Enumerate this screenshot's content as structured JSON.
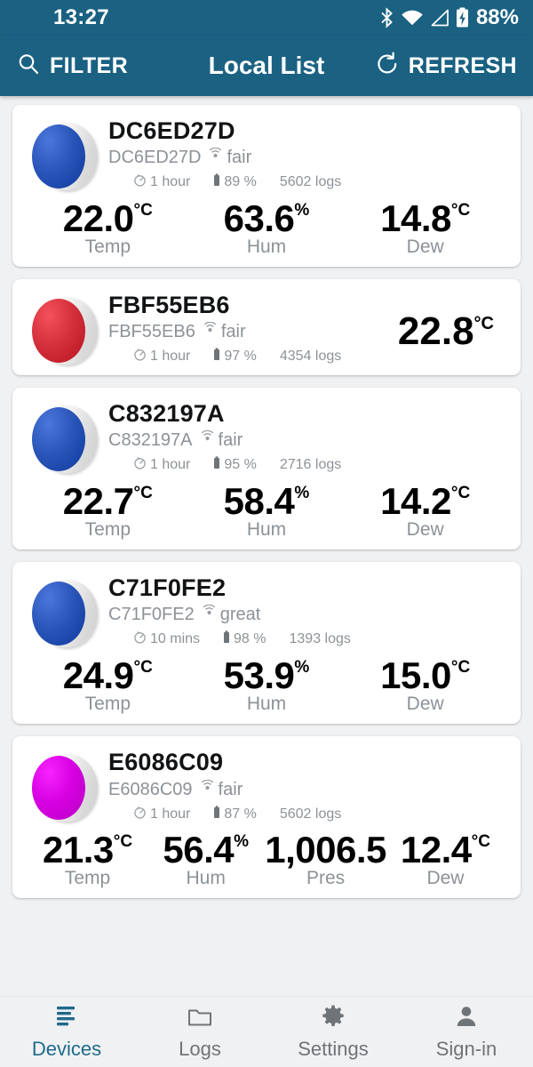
{
  "status_bar": {
    "time": "13:27",
    "battery_percent": "88%",
    "icons": [
      "bluetooth-icon",
      "wifi-icon",
      "cellular-signal-icon",
      "battery-charging-icon"
    ]
  },
  "app_bar": {
    "filter_label": "FILTER",
    "title": "Local List",
    "refresh_label": "REFRESH",
    "background_color": "#1a6182",
    "text_color": "#ffffff"
  },
  "devices": [
    {
      "name": "DC6ED27D",
      "id": "DC6ED27D",
      "quality": "fair",
      "interval": "1 hour",
      "battery": "89 %",
      "logs": "5602 logs",
      "color": "#2a55b8",
      "layout": "three",
      "readings": [
        {
          "value": "22.0",
          "unit": "°C",
          "label": "Temp"
        },
        {
          "value": "63.6",
          "unit": "%",
          "label": "Hum"
        },
        {
          "value": "14.8",
          "unit": "°C",
          "label": "Dew"
        }
      ]
    },
    {
      "name": "FBF55EB6",
      "id": "FBF55EB6",
      "quality": "fair",
      "interval": "1 hour",
      "battery": "97 %",
      "logs": "4354 logs",
      "color": "#d32f3a",
      "layout": "single",
      "single_reading": {
        "value": "22.8",
        "unit": "°C"
      },
      "readings": []
    },
    {
      "name": "C832197A",
      "id": "C832197A",
      "quality": "fair",
      "interval": "1 hour",
      "battery": "95 %",
      "logs": "2716 logs",
      "color": "#2a55b8",
      "layout": "three",
      "readings": [
        {
          "value": "22.7",
          "unit": "°C",
          "label": "Temp"
        },
        {
          "value": "58.4",
          "unit": "%",
          "label": "Hum"
        },
        {
          "value": "14.2",
          "unit": "°C",
          "label": "Dew"
        }
      ]
    },
    {
      "name": "C71F0FE2",
      "id": "C71F0FE2",
      "quality": "great",
      "interval": "10 mins",
      "battery": "98 %",
      "logs": "1393 logs",
      "color": "#2a55b8",
      "layout": "three",
      "readings": [
        {
          "value": "24.9",
          "unit": "°C",
          "label": "Temp"
        },
        {
          "value": "53.9",
          "unit": "%",
          "label": "Hum"
        },
        {
          "value": "15.0",
          "unit": "°C",
          "label": "Dew"
        }
      ]
    },
    {
      "name": "E6086C09",
      "id": "E6086C09",
      "quality": "fair",
      "interval": "1 hour",
      "battery": "87 %",
      "logs": "5602 logs",
      "color": "#d500e0",
      "layout": "four",
      "readings": [
        {
          "value": "21.3",
          "unit": "°C",
          "label": "Temp"
        },
        {
          "value": "56.4",
          "unit": "%",
          "label": "Hum"
        },
        {
          "value": "1,006.5",
          "unit": "",
          "label": "Pres"
        },
        {
          "value": "12.4",
          "unit": "°C",
          "label": "Dew"
        }
      ]
    }
  ],
  "bottom_nav": {
    "active_color": "#1f6a8c",
    "inactive_color": "#6f7478",
    "items": [
      {
        "label": "Devices",
        "icon": "list-icon",
        "active": true
      },
      {
        "label": "Logs",
        "icon": "folder-icon",
        "active": false
      },
      {
        "label": "Settings",
        "icon": "gear-icon",
        "active": false
      },
      {
        "label": "Sign-in",
        "icon": "person-icon",
        "active": false
      }
    ]
  }
}
